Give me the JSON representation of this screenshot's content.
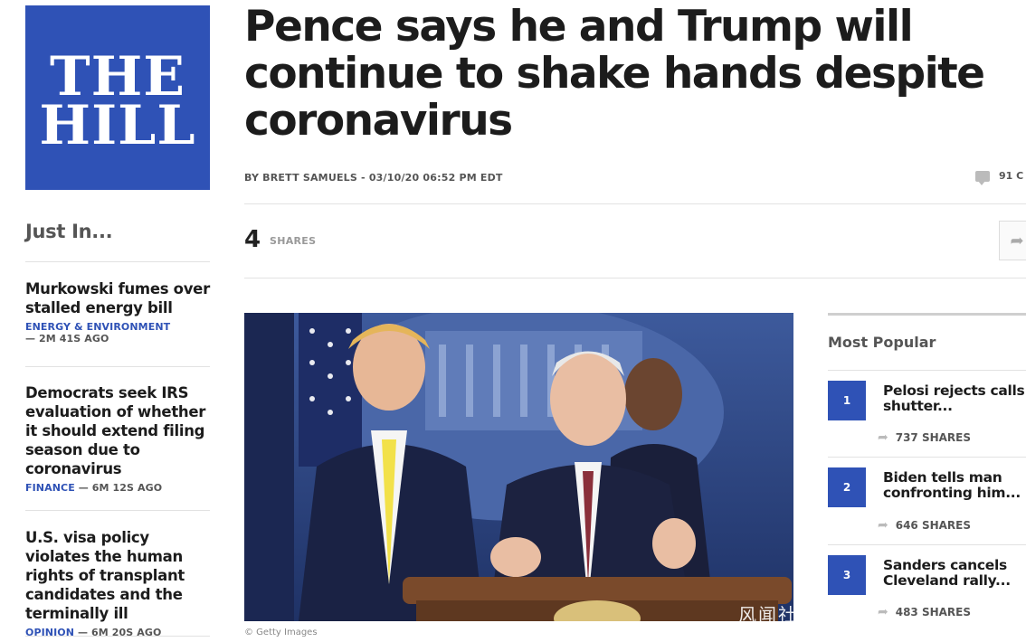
{
  "logo": {
    "line1": "THE",
    "line2": "HILL",
    "color": "#2f52b6"
  },
  "article": {
    "headline": "Pence says he and Trump will continue to shake hands despite coronavirus",
    "byline": "BY BRETT SAMUELS - 03/10/20 06:52 PM EDT",
    "comments": "91 C",
    "share_count": "4",
    "share_label": "SHARES",
    "photo_credit": "© Getty Images"
  },
  "just_in": {
    "heading": "Just In...",
    "items": [
      {
        "title": "Murkowski fumes over stalled energy bill",
        "category": "ENERGY & ENVIRONMENT",
        "time": "— 2M 41S AGO"
      },
      {
        "title": "Democrats seek IRS evaluation of whether it should extend filing season due to coronavirus",
        "category": "FINANCE",
        "time": " — 6M 12S AGO"
      },
      {
        "title": "U.S. visa policy violates the human rights of transplant candidates and the terminally ill",
        "category": "OPINION",
        "time": " — 6M 20S AGO"
      }
    ]
  },
  "most_popular": {
    "heading": "Most Popular",
    "items": [
      {
        "rank": "1",
        "title": "Pelosi rejects calls shutter...",
        "shares": "737 SHARES"
      },
      {
        "rank": "2",
        "title": "Biden tells man confronting him...",
        "shares": "646 SHARES"
      },
      {
        "rank": "3",
        "title": "Sanders cancels Cleveland rally...",
        "shares": "483 SHARES"
      }
    ]
  },
  "watermark": "风闻社区",
  "icons": {
    "comment": "comment-icon",
    "share": "share-arrow-icon"
  }
}
